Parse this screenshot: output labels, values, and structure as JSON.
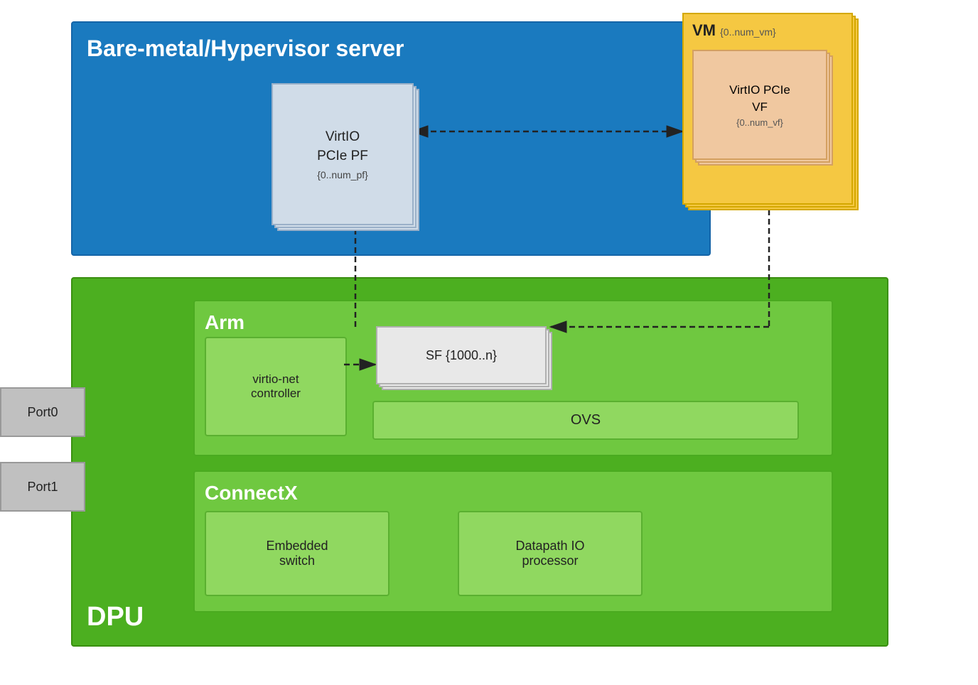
{
  "hypervisor": {
    "title": "Bare-metal/Hypervisor server",
    "pf": {
      "label": "VirtIO\nPCIe PF",
      "sublabel": "{0..num_pf}"
    }
  },
  "vm": {
    "label": "VM",
    "sublabel": "{0..num_vm}",
    "vf": {
      "label": "VirtIO PCIe\nVF",
      "sublabel": "{0..num_vf}"
    }
  },
  "dpu": {
    "title": "DPU",
    "arm": {
      "title": "Arm",
      "virtio_net": "virtio-net\ncontroller",
      "sf": {
        "label": "SF {1000..n}"
      },
      "ovs": "OVS"
    },
    "connectx": {
      "title": "ConnectX",
      "embedded_switch": "Embedded\nswitch",
      "datapath_io": "Datapath IO\nprocessor"
    }
  },
  "ports": {
    "port0": "Port0",
    "port1": "Port1"
  }
}
